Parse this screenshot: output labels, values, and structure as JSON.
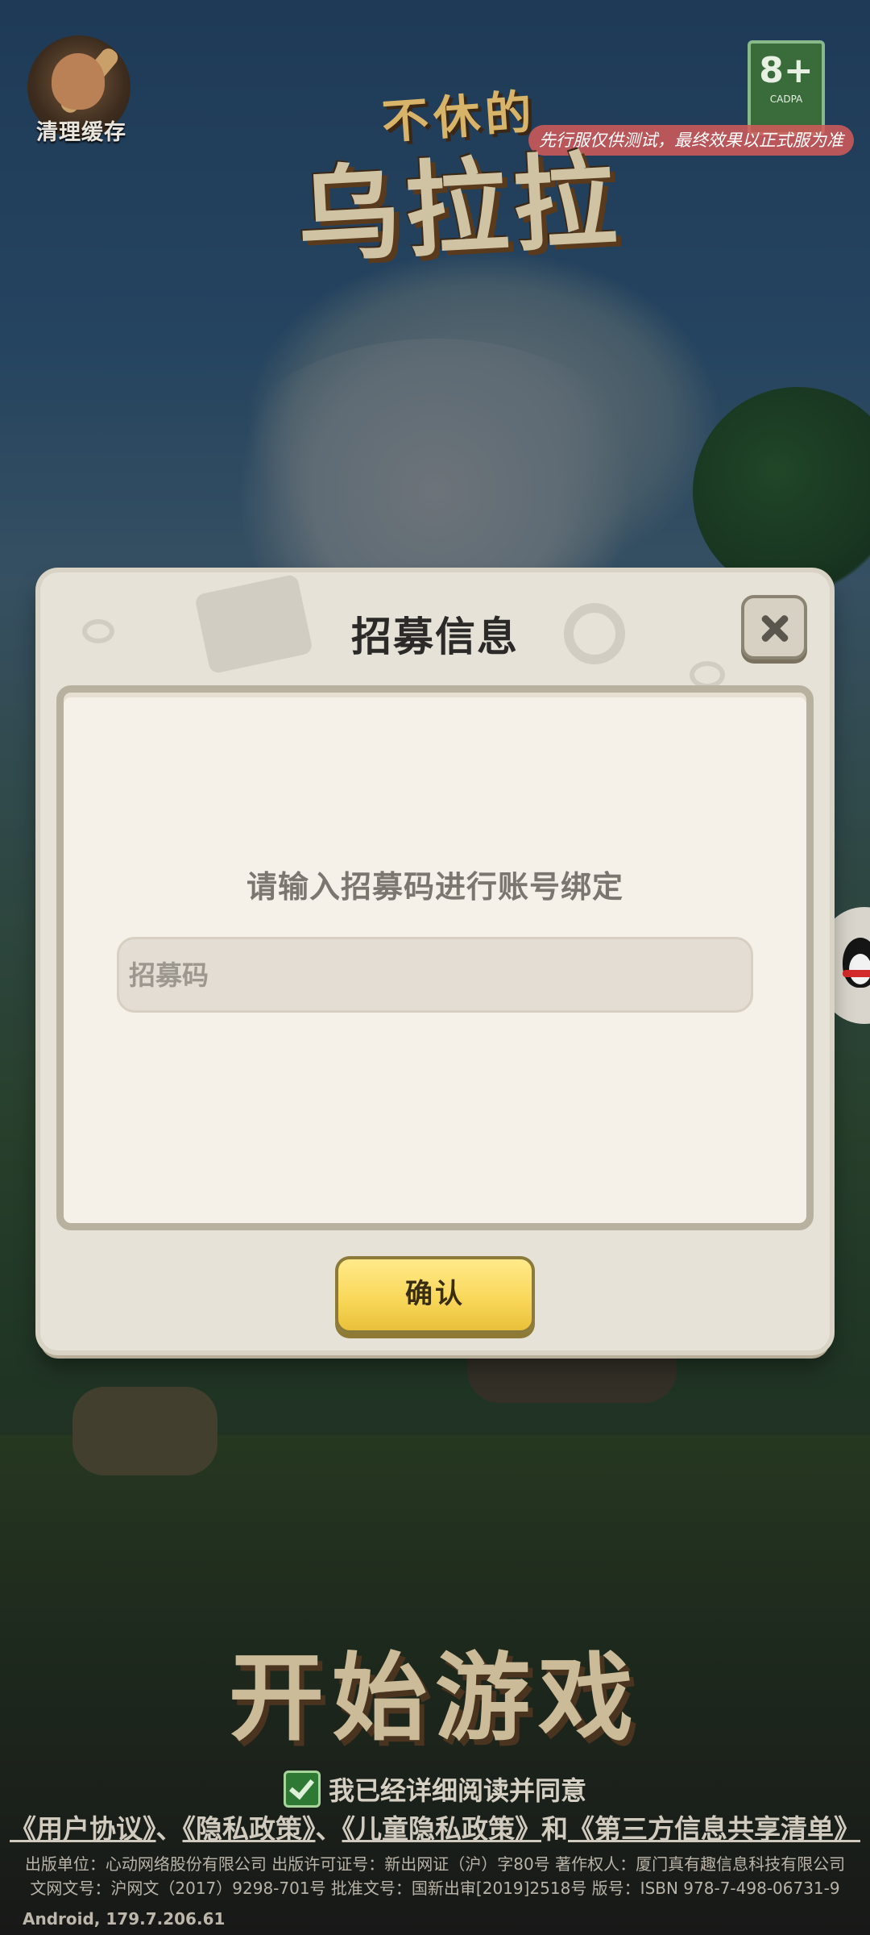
{
  "top": {
    "clear_cache_label": "清理缓存",
    "age_rating": "8+",
    "age_rating_sub": "CADPA",
    "notice": "先行服仅供测试，最终效果以正式服为准"
  },
  "logo": {
    "line1": "不休的",
    "line2": "乌拉拉"
  },
  "dialog": {
    "title": "招募信息",
    "prompt": "请输入招募码进行账号绑定",
    "input_placeholder": "招募码",
    "input_value": "",
    "confirm_label": "确认"
  },
  "bottom": {
    "start_game": "开始游戏",
    "agree_text": "我已经详细阅读并同意",
    "policy_1": "《用户协议》",
    "sep_1": "、",
    "policy_2": "《隐私政策》",
    "sep_2": "、",
    "policy_3": "《儿童隐私政策》",
    "and": "和",
    "policy_4": "《第三方信息共享清单》",
    "legal_line1": "出版单位：心动网络股份有限公司 出版许可证号：新出网证（沪）字80号 著作权人：厦门真有趣信息科技有限公司",
    "legal_line2": "文网文号：沪网文（2017）9298-701号 批准文号：国新出审[2019]2518号 版号：ISBN 978-7-498-06731-9",
    "version": "Android, 179.7.206.61"
  },
  "colors": {
    "confirm_button": "#f9d85a",
    "notice_bg": "#d25a5a",
    "agree_check": "#2e7a35"
  }
}
